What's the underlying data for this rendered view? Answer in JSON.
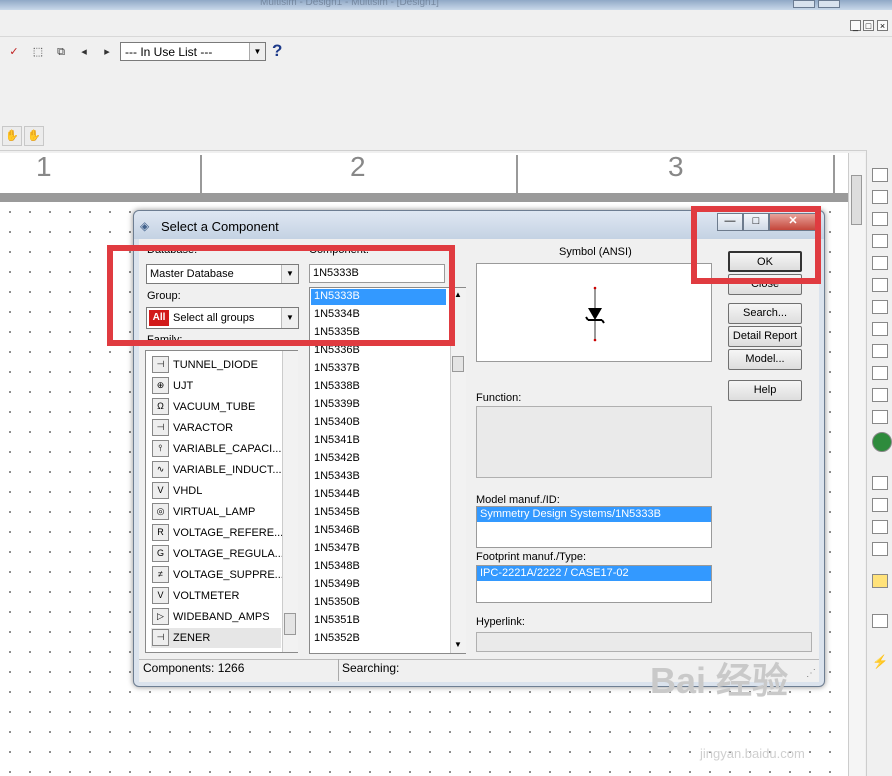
{
  "app": {
    "title": "Multisim - Design1 - Multisim - [Design1]",
    "in_use_select": "--- In Use List ---",
    "help_label": "?",
    "mdi_buttons": [
      "_",
      "□",
      "×"
    ]
  },
  "ruler": {
    "numbers": [
      "1",
      "2",
      "3"
    ]
  },
  "dialog": {
    "title": "Select a Component",
    "window_buttons": {
      "minimize": "—",
      "maximize": "□",
      "close": "✕"
    },
    "database_label": "Database:",
    "database_value": "Master Database",
    "group_label": "Group:",
    "group_badge": "All",
    "group_value": "Select all groups",
    "family_label": "Family:",
    "families": [
      {
        "icon": "tunnel-diode-icon",
        "glyph": "⊣",
        "label": "TUNNEL_DIODE"
      },
      {
        "icon": "ujt-icon",
        "glyph": "⊕",
        "label": "UJT"
      },
      {
        "icon": "vacuum-tube-icon",
        "glyph": "Ω",
        "label": "VACUUM_TUBE"
      },
      {
        "icon": "varactor-icon",
        "glyph": "⊣",
        "label": "VARACTOR"
      },
      {
        "icon": "variable-capacitor-icon",
        "glyph": "⫯",
        "label": "VARIABLE_CAPACI..."
      },
      {
        "icon": "variable-inductor-icon",
        "glyph": "∿",
        "label": "VARIABLE_INDUCT..."
      },
      {
        "icon": "vhdl-icon",
        "glyph": "V",
        "label": "VHDL"
      },
      {
        "icon": "virtual-lamp-icon",
        "glyph": "◎",
        "label": "VIRTUAL_LAMP"
      },
      {
        "icon": "voltage-reference-icon",
        "glyph": "R",
        "label": "VOLTAGE_REFERE..."
      },
      {
        "icon": "voltage-regulator-icon",
        "glyph": "G",
        "label": "VOLTAGE_REGULA..."
      },
      {
        "icon": "voltage-suppressor-icon",
        "glyph": "≠",
        "label": "VOLTAGE_SUPPRE..."
      },
      {
        "icon": "voltmeter-icon",
        "glyph": "V",
        "label": "VOLTMETER"
      },
      {
        "icon": "wideband-amps-icon",
        "glyph": "▷",
        "label": "WIDEBAND_AMPS"
      },
      {
        "icon": "zener-icon",
        "glyph": "⊣",
        "label": "ZENER"
      }
    ],
    "component_label": "Component:",
    "component_value": "1N5333B",
    "components": [
      "1N5333B",
      "1N5334B",
      "1N5335B",
      "1N5336B",
      "1N5337B",
      "1N5338B",
      "1N5339B",
      "1N5340B",
      "1N5341B",
      "1N5342B",
      "1N5343B",
      "1N5344B",
      "1N5345B",
      "1N5346B",
      "1N5347B",
      "1N5348B",
      "1N5349B",
      "1N5350B",
      "1N5351B",
      "1N5352B"
    ],
    "symbol_label": "Symbol (ANSI)",
    "function_label": "Function:",
    "model_label": "Model manuf./ID:",
    "model_value": "Symmetry Design Systems/1N5333B",
    "footprint_label": "Footprint manuf./Type:",
    "footprint_value": "IPC-2221A/2222 / CASE17-02",
    "hyperlink_label": "Hyperlink:",
    "buttons": {
      "ok": "OK",
      "close": "Close",
      "search": "Search...",
      "detail_report": "Detail Report",
      "model": "Model...",
      "help": "Help"
    },
    "status_components": "Components: 1266",
    "status_searching": "Searching:"
  },
  "watermark": {
    "brand": "Bai 经验",
    "url": "jingyan.baidu.com"
  }
}
